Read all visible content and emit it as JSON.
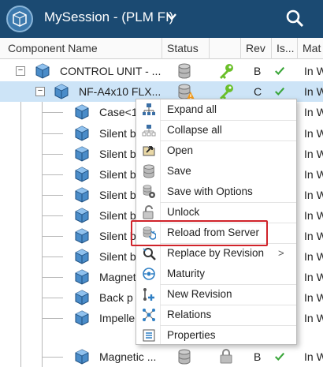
{
  "app": {
    "title": "MySession - (PLM FI)"
  },
  "columns": {
    "name": "Component Name",
    "status": "Status",
    "rev": "Rev",
    "is": "Is...",
    "mat": "Mat"
  },
  "rows": [
    {
      "name": "CONTROL UNIT - ...",
      "rev": "B",
      "mat": "In W"
    },
    {
      "name": "NF-A4x10 FLX...",
      "rev": "C",
      "mat": "In W"
    },
    {
      "name": "Case<1>",
      "mat": "In W"
    },
    {
      "name": "Silent b",
      "mat": "In W"
    },
    {
      "name": "Silent b",
      "mat": "In W"
    },
    {
      "name": "Silent b",
      "mat": "In W"
    },
    {
      "name": "Silent b",
      "mat": "In W"
    },
    {
      "name": "Silent b",
      "mat": "In W"
    },
    {
      "name": "Silent b",
      "mat": "In W"
    },
    {
      "name": "Silent b",
      "mat": "In W"
    },
    {
      "name": "Magnet",
      "mat": "In W"
    },
    {
      "name": "Back p",
      "mat": "In W"
    },
    {
      "name": "Impelle",
      "mat": "In W"
    },
    {
      "name": "Magnetic ...",
      "rev": "B",
      "mat": "In W"
    }
  ],
  "menu": {
    "items": [
      {
        "label": "Expand all",
        "icon": "expand-all-icon"
      },
      {
        "label": "Collapse all",
        "icon": "collapse-all-icon"
      },
      {
        "label": "Open",
        "icon": "open-icon"
      },
      {
        "label": "Save",
        "icon": "save-icon"
      },
      {
        "label": "Save with Options",
        "icon": "save-options-icon"
      },
      {
        "label": "Unlock",
        "icon": "unlock-icon"
      },
      {
        "label": "Reload from Server",
        "icon": "reload-icon"
      },
      {
        "label": "Replace by Revision",
        "icon": "replace-icon",
        "submenu": ">"
      },
      {
        "label": "Maturity",
        "icon": "maturity-icon"
      },
      {
        "label": "New Revision",
        "icon": "new-revision-icon"
      },
      {
        "label": "Relations",
        "icon": "relations-icon"
      },
      {
        "label": "Properties",
        "icon": "properties-icon"
      }
    ]
  },
  "colors": {
    "titlebar": "#1b4a72",
    "selection": "#cde4f7",
    "highlight": "#d0232a",
    "check": "#3aa63a",
    "key": "#6abf2a"
  }
}
